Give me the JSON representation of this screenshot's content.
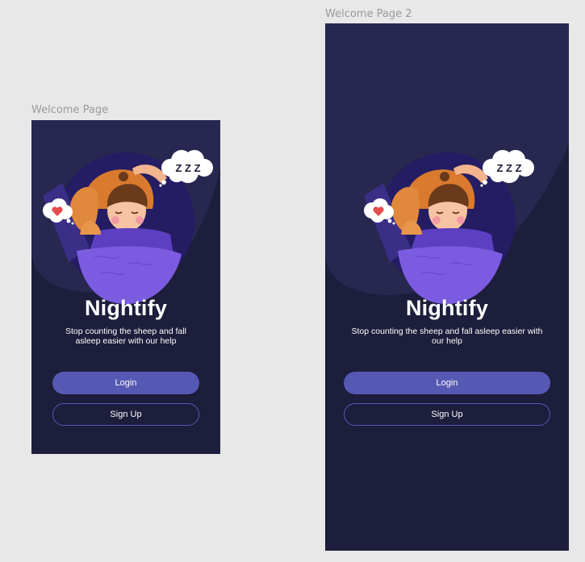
{
  "canvas": {
    "background": "#e8e8e8"
  },
  "frames": [
    {
      "label": "Welcome Page",
      "app_title": "Nightify",
      "tagline": "Stop counting the sheep and fall asleep easier with our help",
      "login_label": "Login",
      "signup_label": "Sign Up"
    },
    {
      "label": "Welcome Page 2",
      "app_title": "Nightify",
      "tagline": "Stop counting the sheep and fall asleep easier with our help",
      "login_label": "Login",
      "signup_label": "Sign Up"
    }
  ],
  "illustration": {
    "dream_text": "Z Z Z",
    "heart_icon": "heart-icon",
    "subject": "sleeping girl with cat"
  },
  "colors": {
    "frame_bg": "#1d1d3c",
    "blob": "#2a2a55",
    "accent": "#5659b3",
    "blanket": "#7b5ce0",
    "text": "#ffffff",
    "label": "#9a9a9a"
  }
}
